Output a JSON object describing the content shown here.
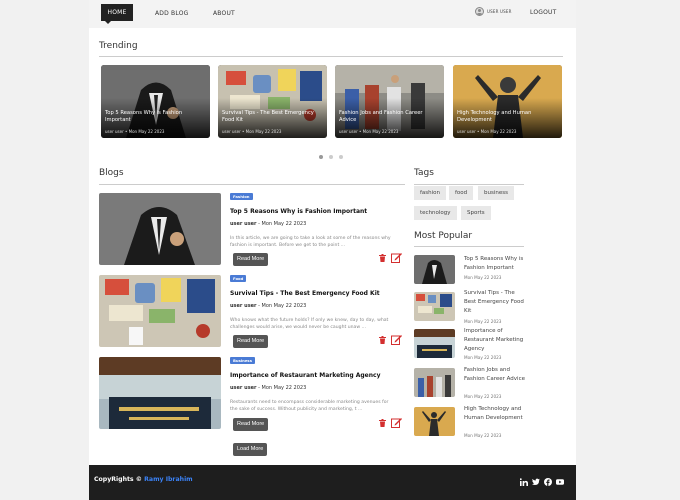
{
  "nav": {
    "home": "HOME",
    "add_blog": "ADD BLOG",
    "about": "ABOUT",
    "user": "USER USER",
    "logout": "LOGOUT"
  },
  "trending": {
    "heading": "Trending",
    "items": [
      {
        "title": "Top 5 Reasons Why is Fashion Important",
        "meta": "user user • Mon May 22 2023"
      },
      {
        "title": "Survival Tips - The Best Emergency Food Kit",
        "meta": "user user • Mon May 22 2023"
      },
      {
        "title": "Fashion Jobs and Fashion Career Advice",
        "meta": "user user • Mon May 22 2023"
      },
      {
        "title": "High Technology and Human Development",
        "meta": "user user • Mon May 22 2023"
      }
    ]
  },
  "blogs": {
    "heading": "Blogs",
    "read_more": "Read More",
    "load_more": "Load More",
    "items": [
      {
        "category": "Fashion",
        "title": "Top 5 Reasons Why is Fashion Important",
        "author": "user user",
        "date": " - Mon May 22 2023",
        "excerpt": "In this article, we are going to take a look at some of the reasons why fashion is important. Before we get to the point ..."
      },
      {
        "category": "Food",
        "title": "Survival Tips - The Best Emergency Food Kit",
        "author": "user user",
        "date": " - Mon May 22 2023",
        "excerpt": "Who knows what the future holds? If only we knew, day to day, what challenges would arise, we would never be caught unaw ..."
      },
      {
        "category": "Business",
        "title": "Importance of Restaurant Marketing Agency",
        "author": "user user",
        "date": " - Mon May 22 2023",
        "excerpt": "Restaurants need to encompass considerable marketing avenues for the sake of success. Without publicity and marketing, t ..."
      }
    ]
  },
  "tags": {
    "heading": "Tags",
    "items": [
      "fashion",
      "food",
      "business",
      "technology",
      "Sports"
    ]
  },
  "popular": {
    "heading": "Most Popular",
    "items": [
      {
        "title": "Top 5 Reasons Why is Fashion Important",
        "meta": "Mon May 22 2023"
      },
      {
        "title": "Survival Tips - The Best Emergency Food Kit",
        "meta": "Mon May 22 2023"
      },
      {
        "title": "Importance of Restaurant Marketing Agency",
        "meta": "Mon May 22 2023"
      },
      {
        "title": "Fashion Jobs and Fashion Career Advice",
        "meta": "Mon May 22 2023"
      },
      {
        "title": "High Technology and Human Development",
        "meta": "Mon May 22 2023"
      }
    ]
  },
  "footer": {
    "copyright": "CopyRights © ",
    "name": "Ramy Ibrahim"
  },
  "icons": {
    "trash": "trash-icon",
    "edit": "edit-icon",
    "social": [
      "linkedin-icon",
      "twitter-icon",
      "facebook-icon",
      "youtube-icon"
    ]
  },
  "colors": {
    "badge": "#4a7bd5",
    "danger": "#d32f2f",
    "footer_name": "#3b82f6",
    "nav_active": "#222222"
  }
}
